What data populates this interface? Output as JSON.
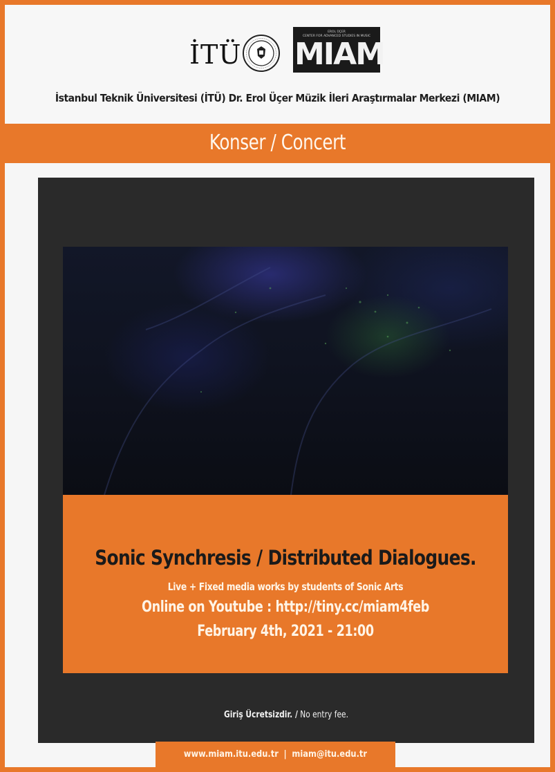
{
  "header": {
    "itu_logo_text": "İTÜ",
    "seal_text": "İSTANBUL TEKNİK ÜNİVERSİTESİ 1773",
    "miam_small_line1": "EROL ÜÇER",
    "miam_small_line2": "CENTER FOR ADVANCED STUDIES IN MUSIC",
    "miam_logo_text": "MIAM",
    "institution_line": "İstanbul Teknik Üniversitesi (İTÜ)  Dr. Erol Üçer Müzik İleri Araştırmalar Merkezi (MIAM)"
  },
  "band": {
    "title": "Konser / Concert"
  },
  "event": {
    "title": "Sonic Synchresis / Distributed Dialogues.",
    "subtitle": "Live + Fixed media works by students of Sonic Arts",
    "online": "Online on Youtube : http://tiny.cc/miam4feb",
    "date": "February 4th, 2021 - 21:00"
  },
  "entry": {
    "bold": "Giriş Ücretsizdir. /",
    "normal": " No entry fee."
  },
  "footer": {
    "website": "www.miam.itu.edu.tr",
    "separator": "|",
    "email": "miam@itu.edu.tr"
  },
  "colors": {
    "accent_orange": "#e8782a",
    "card_dark": "#2a2a2a",
    "background": "#f6f6f6"
  }
}
